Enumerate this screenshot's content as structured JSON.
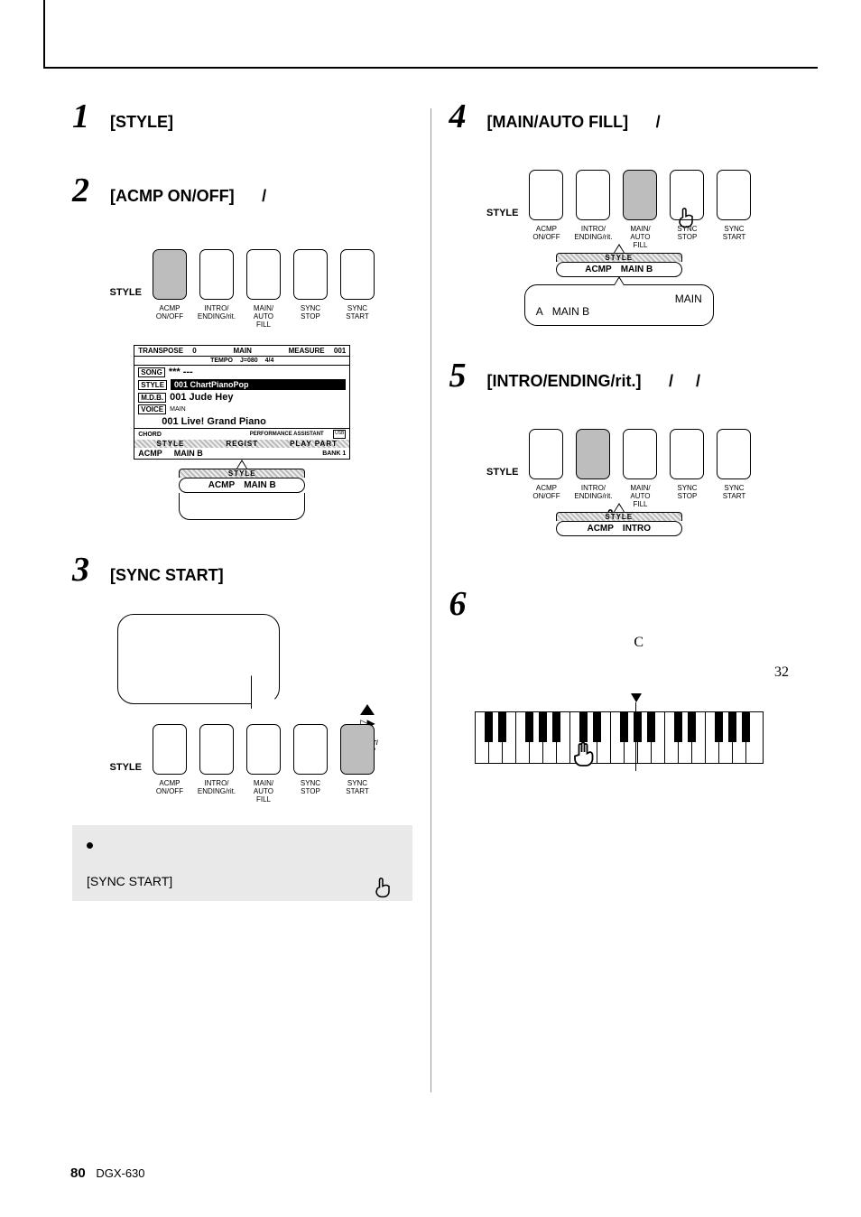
{
  "header": {},
  "left": {
    "step1": {
      "num": "1",
      "title": "[STYLE]"
    },
    "step2": {
      "num": "2",
      "title": "[ACMP ON/OFF]",
      "slash": "/",
      "style_label": "STYLE",
      "btns": [
        {
          "label": "ACMP\nON/OFF",
          "shaded": true
        },
        {
          "label": "INTRO/\nENDING/rit.",
          "shaded": false
        },
        {
          "label": "MAIN/\nAUTO FILL",
          "shaded": false
        },
        {
          "label": "SYNC\nSTOP",
          "shaded": false
        },
        {
          "label": "SYNC\nSTART",
          "shaded": false
        }
      ],
      "lcd": {
        "topbar": "MAIN",
        "transpose_label": "TRANSPOSE",
        "transpose": "0",
        "tempo_label": "TEMPO",
        "tempo": "J=080",
        "sig": "4/4",
        "measure_label": "MEASURE",
        "measure": "001",
        "song_tag": "SONG",
        "song": "*** ---",
        "style_tag": "STYLE",
        "style_name": "001 ChartPianoPop",
        "mdb_tag": "M.D.B.",
        "mdb": "001 Jude Hey",
        "voice_tag": "VOICE",
        "voice_sub": "MAIN",
        "voice": "001 Live! Grand Piano",
        "chord_tag": "CHORD",
        "perf": "PERFORMANCE ASSISTANT",
        "stripe_style": "STYLE",
        "stripe_regist": "REGIST",
        "stripe_play": "PLAY PART",
        "acmp": "ACMP",
        "mainb": "MAIN B",
        "bank": "BANK 1"
      },
      "callout": {
        "stripe": "STYLE",
        "acmp": "ACMP",
        "mainb": "MAIN B"
      }
    },
    "step3": {
      "num": "3",
      "title": "[SYNC START]",
      "style_label": "STYLE",
      "start_stop": "START/\nSTOP",
      "btns": [
        {
          "label": "ACMP\nON/OFF",
          "shaded": false
        },
        {
          "label": "INTRO/\nENDING/rit.",
          "shaded": false
        },
        {
          "label": "MAIN/\nAUTO FILL",
          "shaded": false
        },
        {
          "label": "SYNC\nSTOP",
          "shaded": false
        },
        {
          "label": "SYNC\nSTART",
          "shaded": true
        }
      ]
    },
    "note": {
      "text": "[SYNC START]"
    }
  },
  "right": {
    "step4": {
      "num": "4",
      "title": "[MAIN/AUTO FILL]",
      "slash": "/",
      "style_label": "STYLE",
      "btns": [
        {
          "label": "ACMP\nON/OFF",
          "shaded": false
        },
        {
          "label": "INTRO/\nENDING/rit.",
          "shaded": false
        },
        {
          "label": "MAIN/\nAUTO FILL",
          "shaded": true
        },
        {
          "label": "SYNC\nSTOP",
          "shaded": false
        },
        {
          "label": "SYNC\nSTART",
          "shaded": false
        }
      ],
      "callout": {
        "stripe": "STYLE",
        "acmp": "ACMP",
        "mainb": "MAIN B"
      },
      "desc_a": "A",
      "desc_mainb": "MAIN B",
      "desc_main": "MAIN"
    },
    "step5": {
      "num": "5",
      "title": "[INTRO/ENDING/rit.]",
      "slashes": "/     /",
      "style_label": "STYLE",
      "btns": [
        {
          "label": "ACMP\nON/OFF",
          "shaded": false
        },
        {
          "label": "INTRO/\nENDING/rit.",
          "shaded": true
        },
        {
          "label": "MAIN/\nAUTO FILL",
          "shaded": false
        },
        {
          "label": "SYNC\nSTOP",
          "shaded": false
        },
        {
          "label": "SYNC\nSTART",
          "shaded": false
        }
      ],
      "callout": {
        "stripe": "STYLE",
        "acmp": "ACMP",
        "intro": "INTRO"
      }
    },
    "step6": {
      "num": "6",
      "body_c": "C",
      "body_32": "32"
    }
  },
  "footer": {
    "page": "80",
    "model": "DGX-630"
  }
}
